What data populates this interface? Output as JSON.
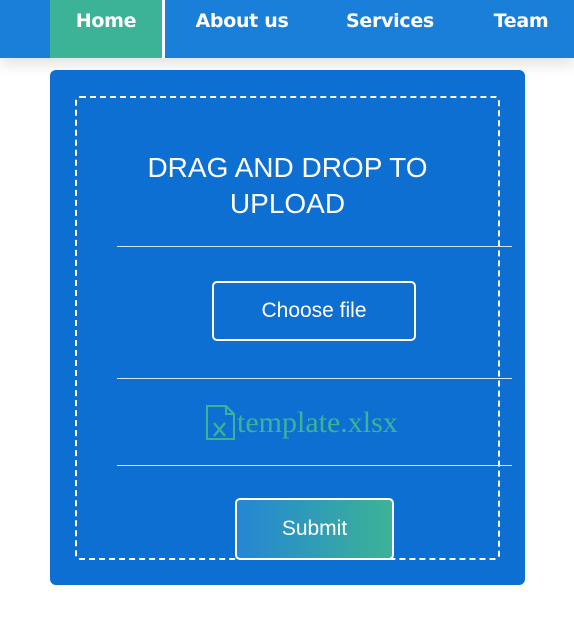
{
  "nav": {
    "items": [
      {
        "label": "Home",
        "active": true
      },
      {
        "label": "About us"
      },
      {
        "label": "Services"
      },
      {
        "label": "Team"
      }
    ]
  },
  "upload": {
    "title_line1": "DRAG AND DROP TO",
    "title_line2": "UPLOAD",
    "choose_label": "Choose file",
    "file_name": "template.xlsx",
    "file_icon": "excel-file-icon",
    "submit_label": "Submit"
  },
  "colors": {
    "nav_bg": "#1a7fd9",
    "active_tab": "#3cb396",
    "card_bg": "#0e6fd2",
    "file_accent": "#3cb396"
  }
}
